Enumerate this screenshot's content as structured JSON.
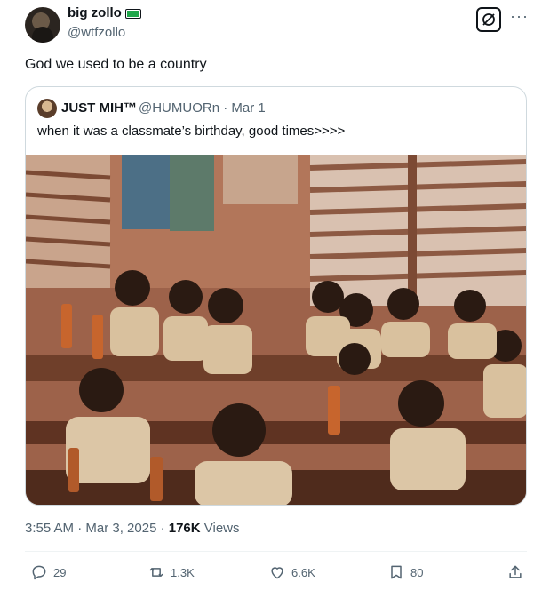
{
  "author": {
    "display_name": "big zollo",
    "handle": "@wtfzollo",
    "badge_icon": "battery-badge-icon"
  },
  "tweet": {
    "text": "God we used to be a country"
  },
  "quoted": {
    "display_name": "JUST MIH™",
    "handle_date": "@HUMUORn · Mar 1",
    "text": "when it was a classmate’s birthday, good times>>>>",
    "image": "photo of children in school uniforms drinking soda through straws in a classroom"
  },
  "meta": {
    "time_date": "3:55 AM · Mar 3, 2025 · ",
    "views_count": "176K",
    "views_label": " Views"
  },
  "actions": {
    "replies": "29",
    "reposts": "1.3K",
    "likes": "6.6K",
    "bookmarks": "80"
  },
  "colors": {
    "text_primary": "#0f1419",
    "text_secondary": "#536471",
    "border": "#cfd9de"
  }
}
